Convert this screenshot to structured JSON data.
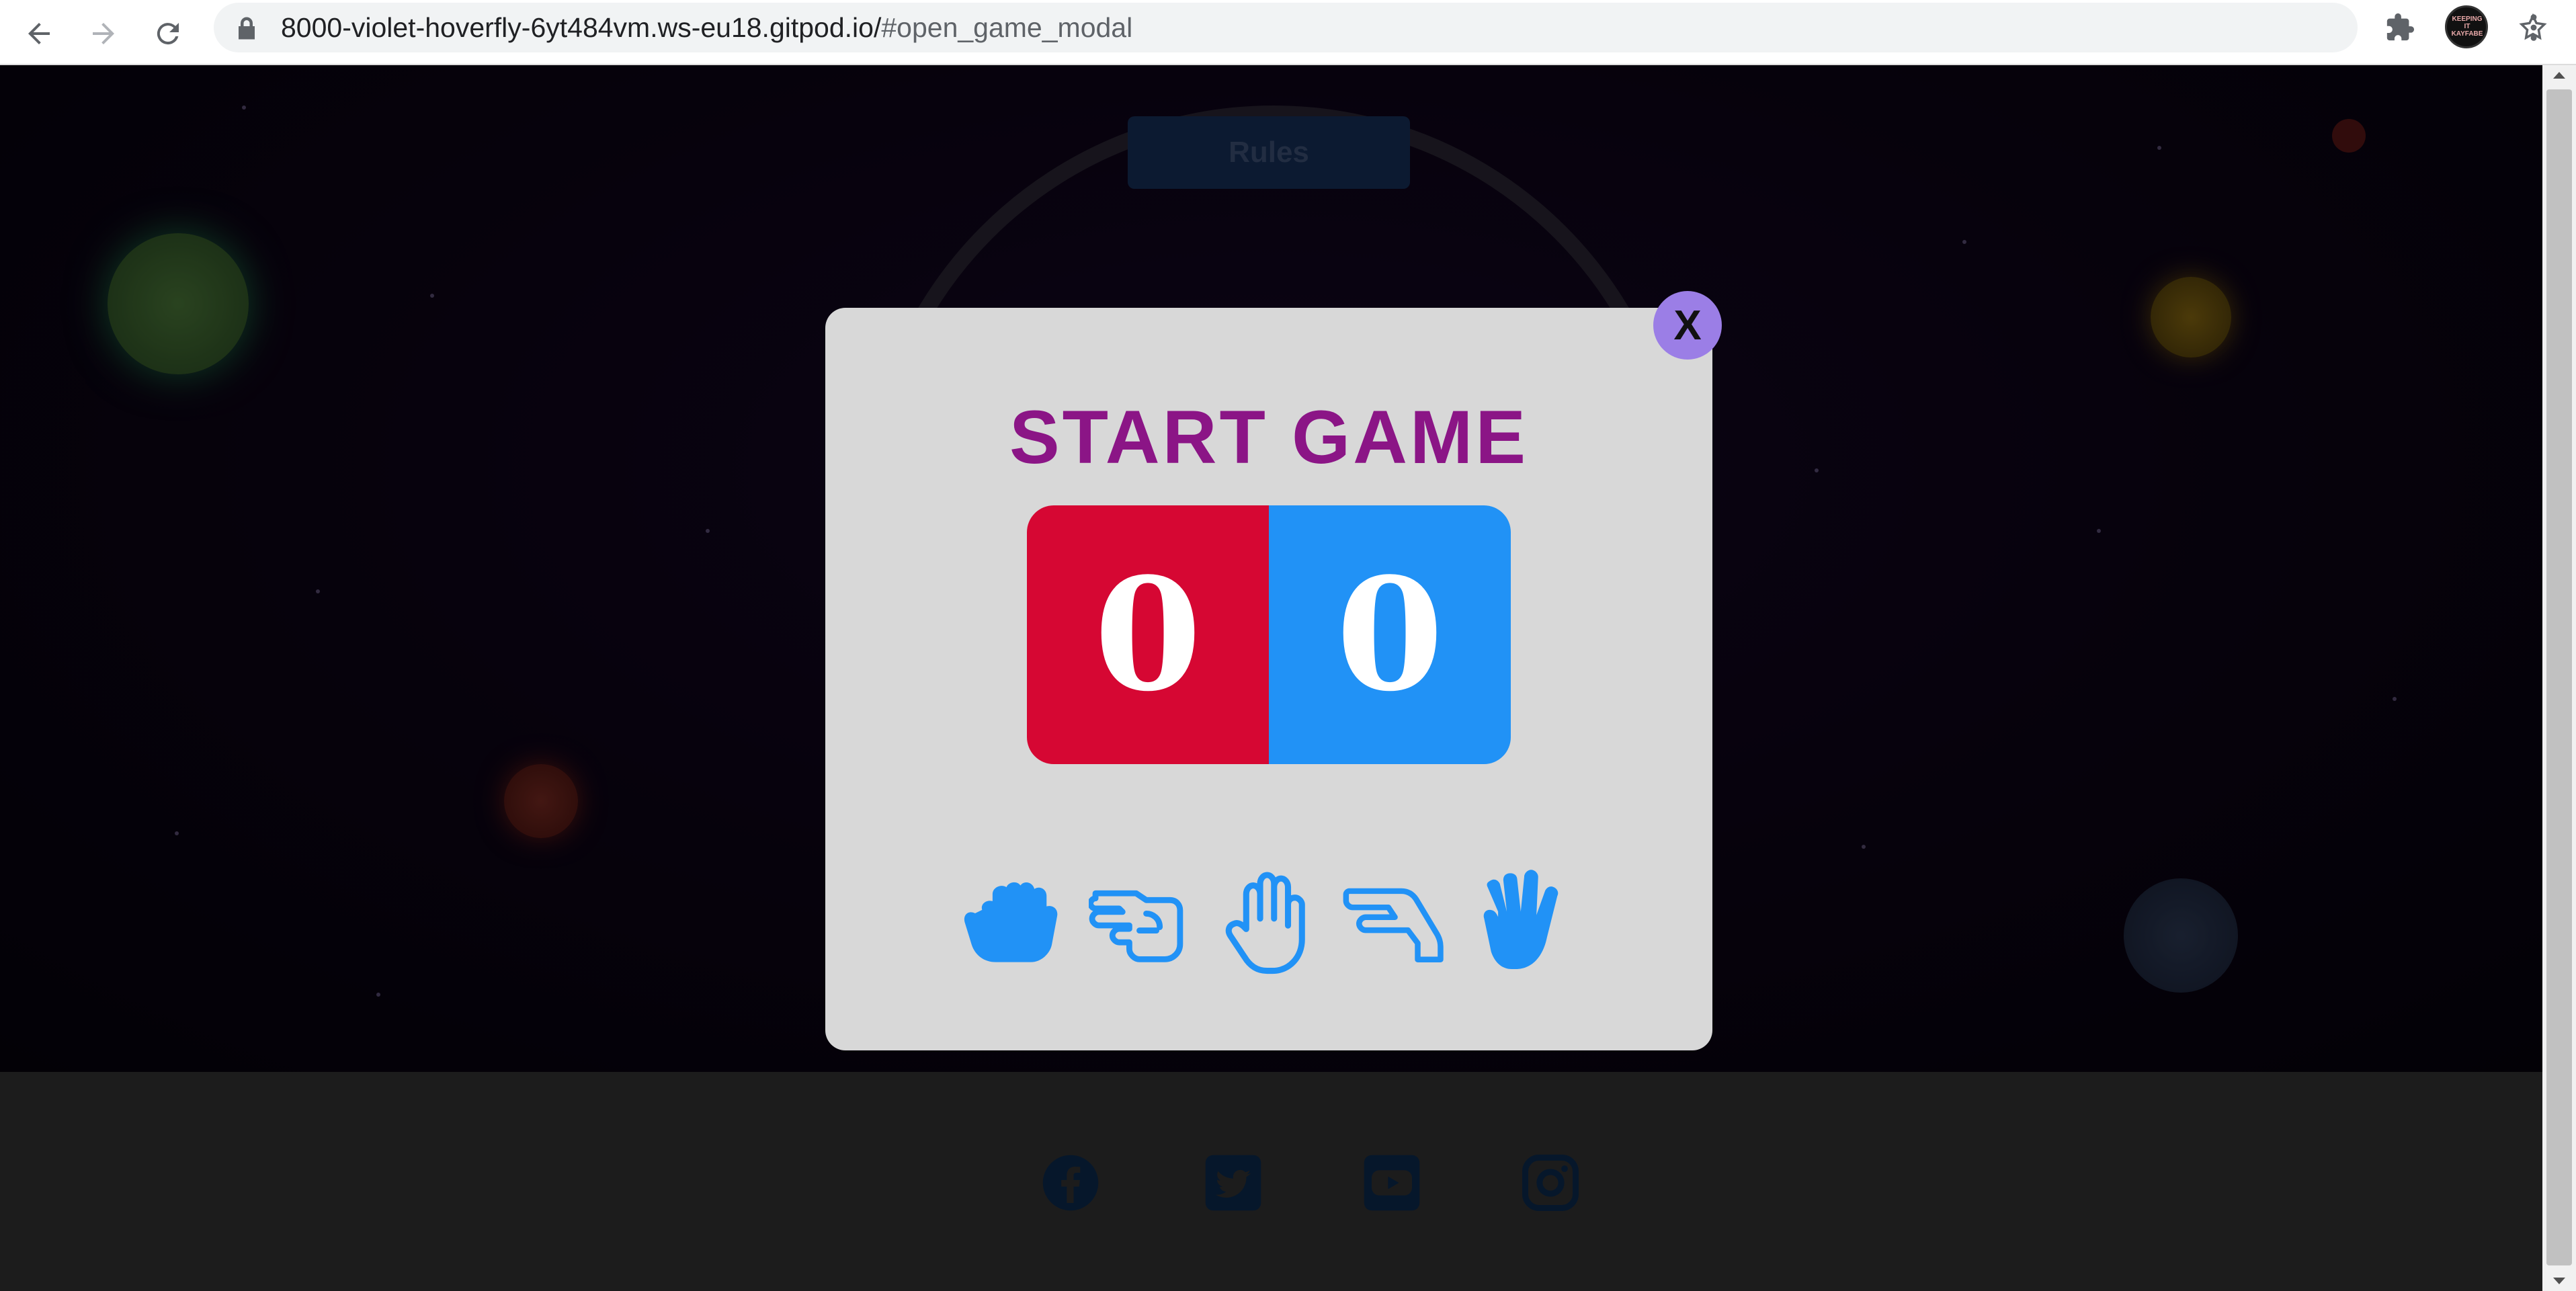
{
  "browser": {
    "url_host": "8000-violet-hoverfly-6yt484vm.ws-eu18.gitpod.io/",
    "url_fragment": "#open_game_modal",
    "avatar_text": "KEEPING IT KAYFABE"
  },
  "page": {
    "rules_label": "Rules",
    "social_links": [
      "facebook-icon",
      "twitter-icon",
      "youtube-icon",
      "instagram-icon"
    ]
  },
  "modal": {
    "close_label": "X",
    "title": "START GAME",
    "player_score": "0",
    "computer_score": "0",
    "choices": [
      "rock-icon",
      "scissors-icon",
      "paper-icon",
      "lizard-icon",
      "spock-icon"
    ]
  },
  "colors": {
    "title": "#8b1586",
    "player": "#d60733",
    "computer": "#2192f6",
    "close": "#9b7ee6",
    "hands": "#2192f6",
    "modal_bg": "#d8d8d8"
  }
}
